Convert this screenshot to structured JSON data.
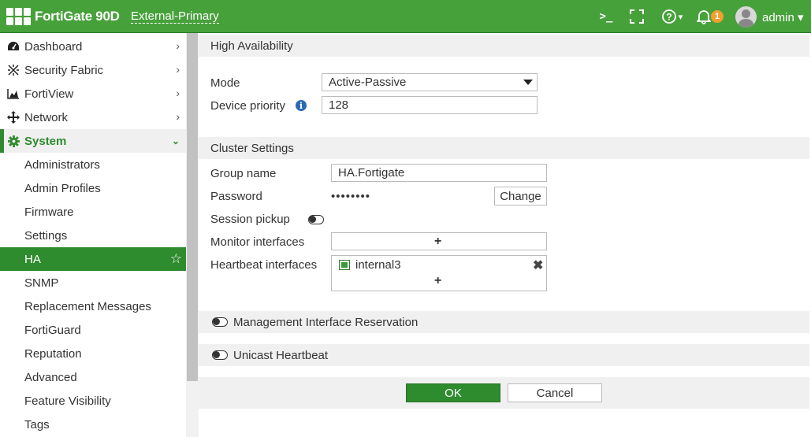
{
  "header": {
    "brand": "FortiGate 90D",
    "hostname": "External-Primary",
    "cli_icon": "cli-terminal-icon",
    "fullscreen_icon": "fullscreen-icon",
    "help_icon": "help-icon",
    "help_caret": "▾",
    "notification_icon": "bell-icon",
    "notification_count": "1",
    "user": "admin ▾"
  },
  "sidebar": {
    "items": [
      {
        "label": "Dashboard",
        "icon": "dashboard-icon"
      },
      {
        "label": "Security Fabric",
        "icon": "security-fabric-icon"
      },
      {
        "label": "FortiView",
        "icon": "fortiview-icon"
      },
      {
        "label": "Network",
        "icon": "network-icon"
      },
      {
        "label": "System",
        "icon": "gear-icon",
        "expanded": true
      },
      {
        "label": "Administrators"
      },
      {
        "label": "Admin Profiles"
      },
      {
        "label": "Firmware"
      },
      {
        "label": "Settings"
      },
      {
        "label": "HA",
        "active": true
      },
      {
        "label": "SNMP"
      },
      {
        "label": "Replacement Messages"
      },
      {
        "label": "FortiGuard"
      },
      {
        "label": "Reputation"
      },
      {
        "label": "Advanced"
      },
      {
        "label": "Feature Visibility"
      },
      {
        "label": "Tags"
      }
    ]
  },
  "main": {
    "title": "High Availability",
    "mode_label": "Mode",
    "mode_value": "Active-Passive",
    "priority_label": "Device priority",
    "priority_value": "128",
    "cluster_title": "Cluster Settings",
    "group_name_label": "Group name",
    "group_name_value": "HA.Fortigate",
    "password_label": "Password",
    "password_value": "••••••••",
    "change_label": "Change",
    "session_pickup_label": "Session pickup",
    "session_pickup_enabled": false,
    "monitor_label": "Monitor interfaces",
    "heartbeat_label": "Heartbeat interfaces",
    "heartbeat_interfaces": [
      "internal3"
    ],
    "mgmt_reservation_label": "Management Interface Reservation",
    "mgmt_reservation_enabled": false,
    "unicast_label": "Unicast Heartbeat",
    "unicast_enabled": false,
    "ok_label": "OK",
    "cancel_label": "Cancel"
  },
  "colors": {
    "brand_green": "#47a13b",
    "active_green": "#2e8b2e",
    "badge_orange": "#f0a030",
    "info_blue": "#2a6ab2"
  }
}
